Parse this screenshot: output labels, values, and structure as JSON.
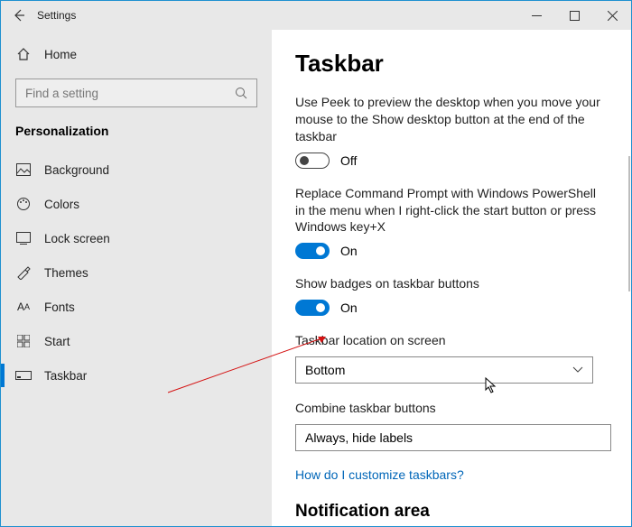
{
  "titlebar": {
    "title": "Settings"
  },
  "sidebar": {
    "home": "Home",
    "search_placeholder": "Find a setting",
    "section": "Personalization",
    "items": [
      {
        "label": "Background"
      },
      {
        "label": "Colors"
      },
      {
        "label": "Lock screen"
      },
      {
        "label": "Themes"
      },
      {
        "label": "Fonts"
      },
      {
        "label": "Start"
      },
      {
        "label": "Taskbar"
      }
    ]
  },
  "main": {
    "title": "Taskbar",
    "items": [
      {
        "label": "Use Peek to preview the desktop when you move your mouse to the Show desktop button at the end of the taskbar",
        "state": "Off",
        "on": false
      },
      {
        "label": "Replace Command Prompt with Windows PowerShell in the menu when I right-click the start button or press Windows key+X",
        "state": "On",
        "on": true
      },
      {
        "label": "Show badges on taskbar buttons",
        "state": "On",
        "on": true
      }
    ],
    "loc_label": "Taskbar location on screen",
    "loc_value": "Bottom",
    "combine_label": "Combine taskbar buttons",
    "combine_value": "Always, hide labels",
    "link": "How do I customize taskbars?",
    "section2": "Notification area"
  }
}
